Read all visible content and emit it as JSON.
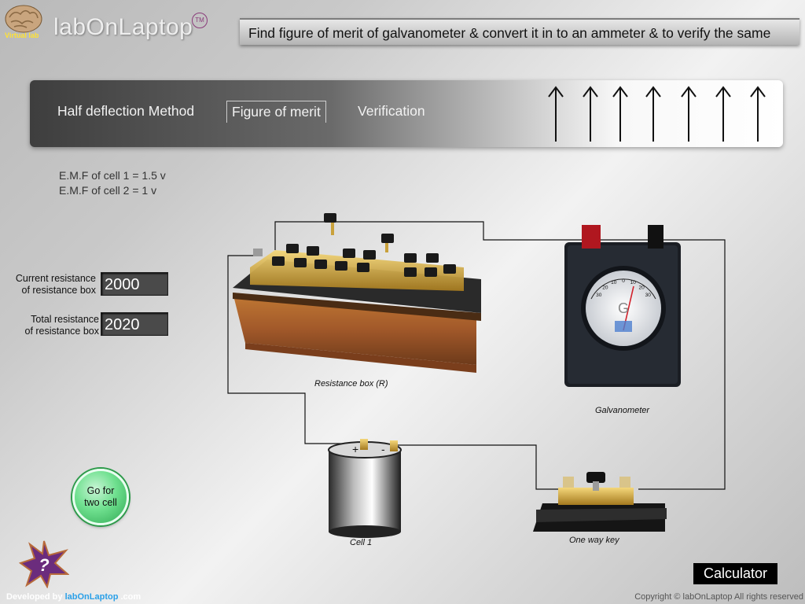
{
  "header": {
    "logo_text": "Virtual lab",
    "brand": "labOnLaptop",
    "trademark": "TM",
    "title": "Find figure of merit of galvanometer & convert it in to an ammeter & to verify the same"
  },
  "nav": {
    "tabs": [
      {
        "label": "Half deflection Method",
        "active": false
      },
      {
        "label": "Figure of merit",
        "active": true
      },
      {
        "label": "Verification",
        "active": false
      }
    ],
    "arrow_count": 7
  },
  "emf": {
    "cell1": "E.M.F of cell 1  =  1.5 v",
    "cell2": "E.M.F of cell 2  =  1 v"
  },
  "fields": {
    "current_resistance": {
      "label_line1": "Current resistance",
      "label_line2": "of resistance box",
      "value": "2000"
    },
    "total_resistance": {
      "label_line1": "Total resistance",
      "label_line2": "of resistance box",
      "value": "2020"
    }
  },
  "circuit": {
    "resistance_box_label": "Resistance box (R)",
    "galvanometer_label": "Galvanometer",
    "galvanometer_letter": "G",
    "galvanometer_scale": [
      "30",
      "20",
      "10",
      "0",
      "10",
      "20",
      "30"
    ],
    "cell_label": "Cell 1",
    "key_label": "One way key",
    "cell_plus": "+",
    "cell_minus": "-"
  },
  "buttons": {
    "go_line1": "Go for",
    "go_line2": "two cell",
    "calculator": "Calculator",
    "help_symbol": "?"
  },
  "footer": {
    "developed_by": "Developed by",
    "dev_link": "labOnLaptop",
    "dev_suffix": ".com",
    "copyright": "Copyright © labOnLaptop All rights reserved"
  },
  "colors": {
    "accent_green": "#2fa852",
    "nav_dark": "#3e3e3e",
    "wood": "#a9652a",
    "brass": "#c9a13b"
  }
}
